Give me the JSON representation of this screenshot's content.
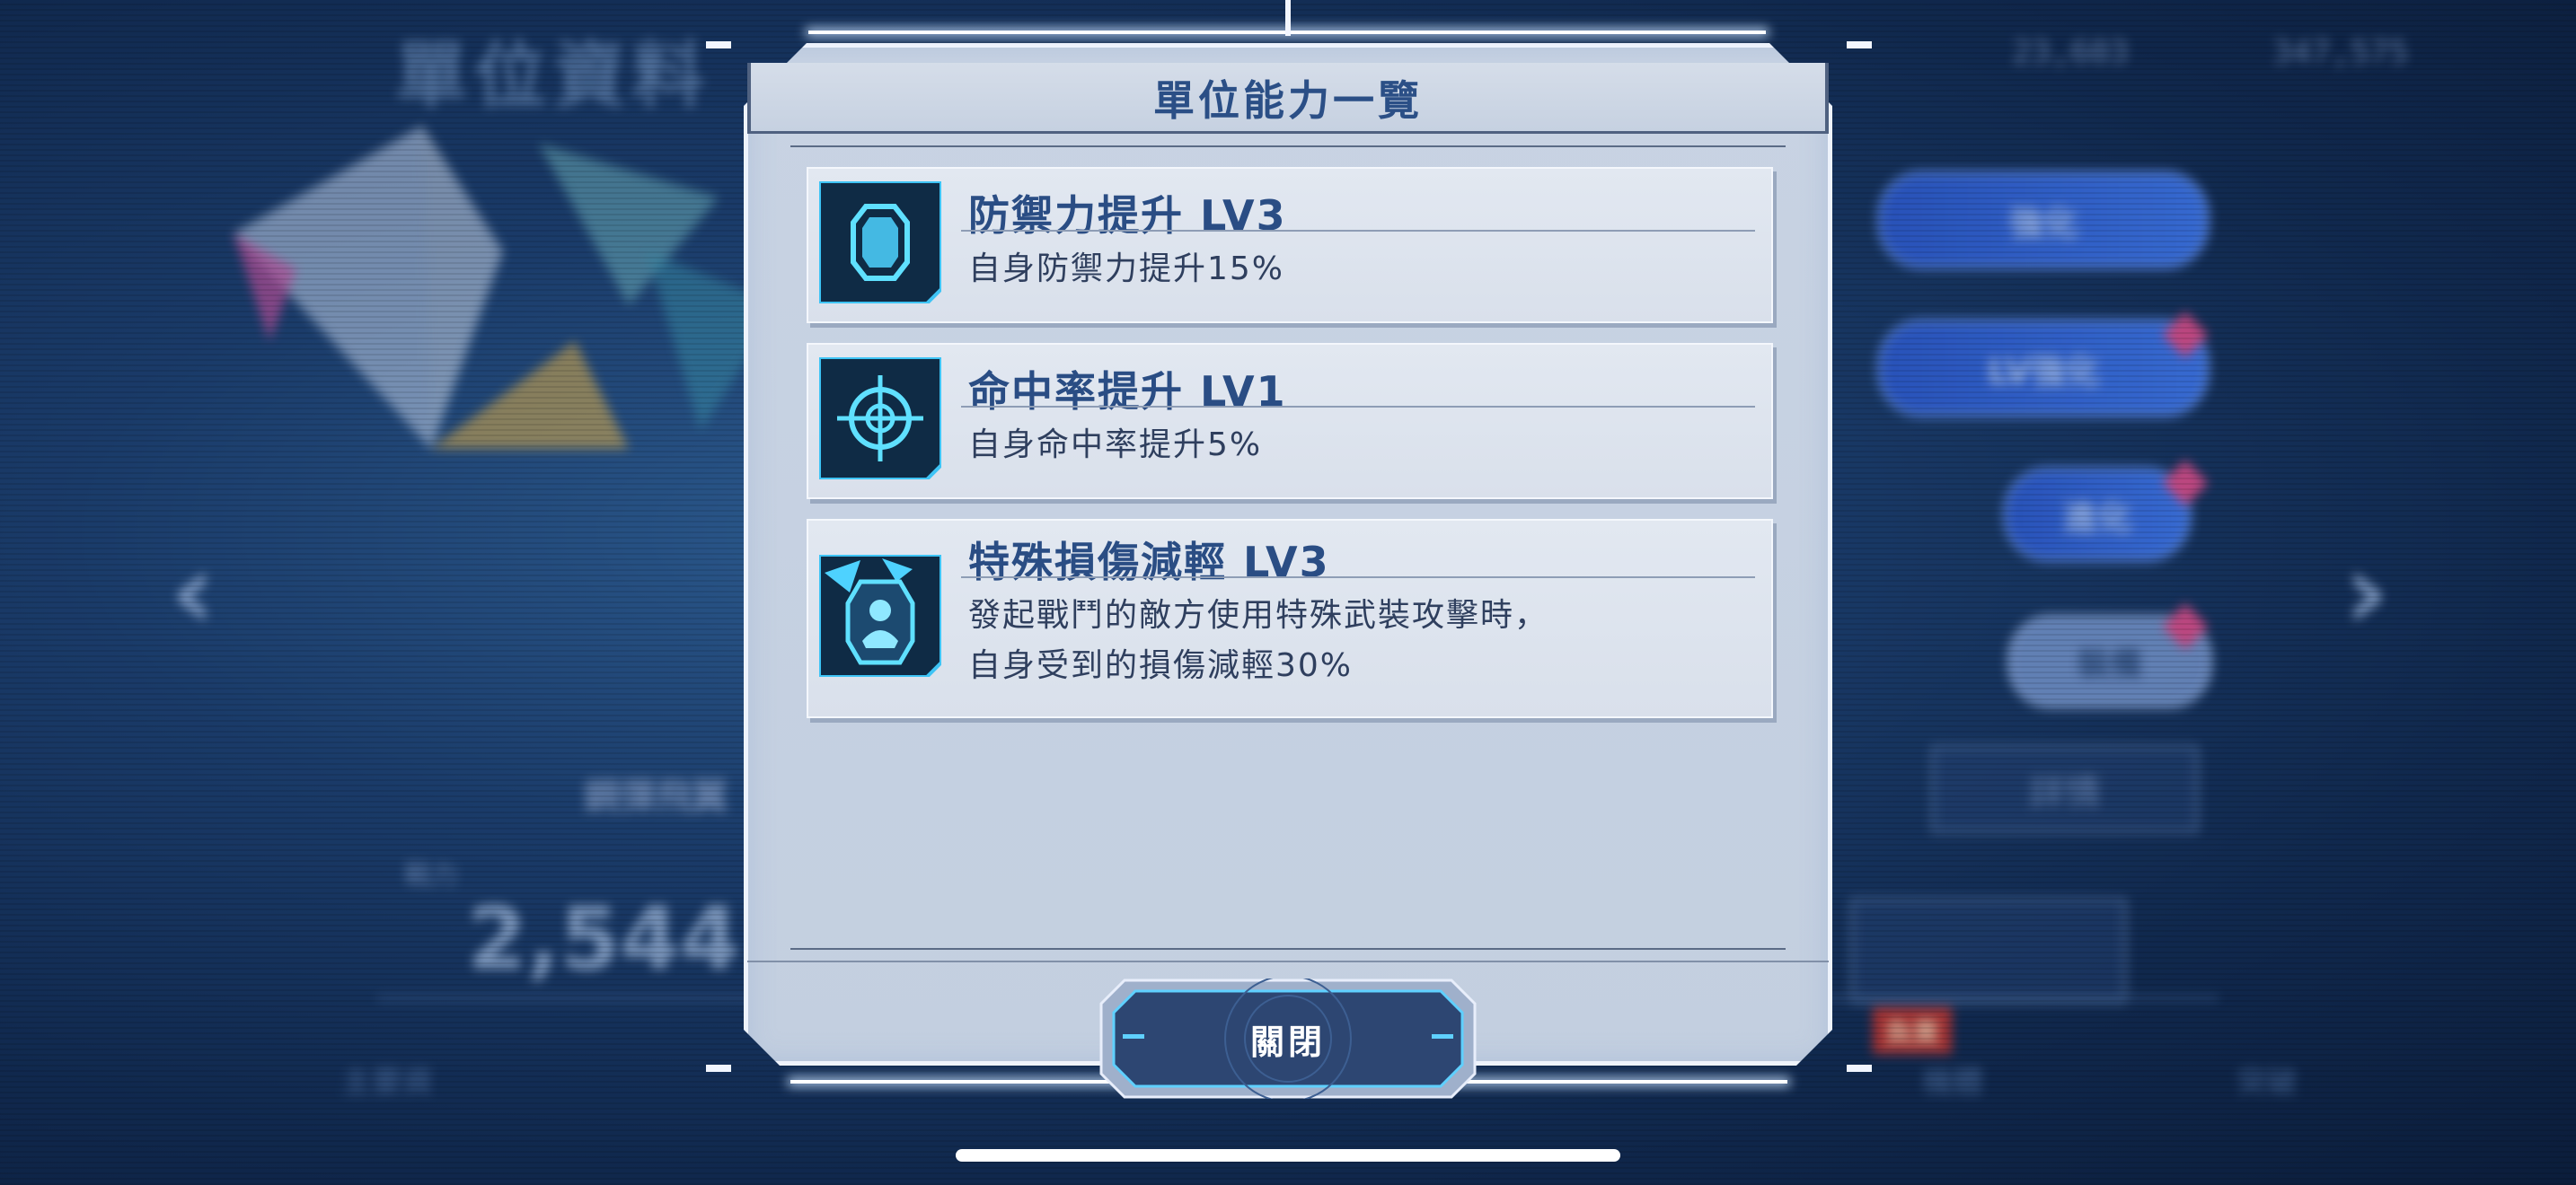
{
  "background": {
    "screen_title": "單位資料",
    "resource_1": "23,603",
    "resource_2": "347,575",
    "power_label": "戰力",
    "power_value": "2,544",
    "unit_name": "鋼彈飛翼",
    "upgrade_button": "強化",
    "lv_upgrade_button": "LV強化",
    "evolve_button": "進化",
    "equip_button": "裝備",
    "detail_button": "詳情",
    "tab_main": "主要資",
    "tab_unit": "機體",
    "tab_right": "突破",
    "tag_red": "負責"
  },
  "modal": {
    "title": "單位能力一覽",
    "close_label": "關閉",
    "abilities": [
      {
        "icon": "shield-icon",
        "name": "防禦力提升 LV3",
        "desc_line1": "自身防禦力提升15%"
      },
      {
        "icon": "crosshair-icon",
        "name": "命中率提升 LV1",
        "desc_line1": "自身命中率提升5%"
      },
      {
        "icon": "armored-pilot-icon",
        "name": "特殊損傷減輕 LV3",
        "desc_line1": "發起戰鬥的敵方使用特殊武裝攻擊時，",
        "desc_line2": "自身受到的損傷減輕30%"
      }
    ]
  },
  "colors": {
    "accent_blue": "#2b4f86",
    "modal_bg": "#c8d3e3",
    "icon_cyan": "#4ed2ff",
    "close_button_bg": "#2d4672"
  }
}
